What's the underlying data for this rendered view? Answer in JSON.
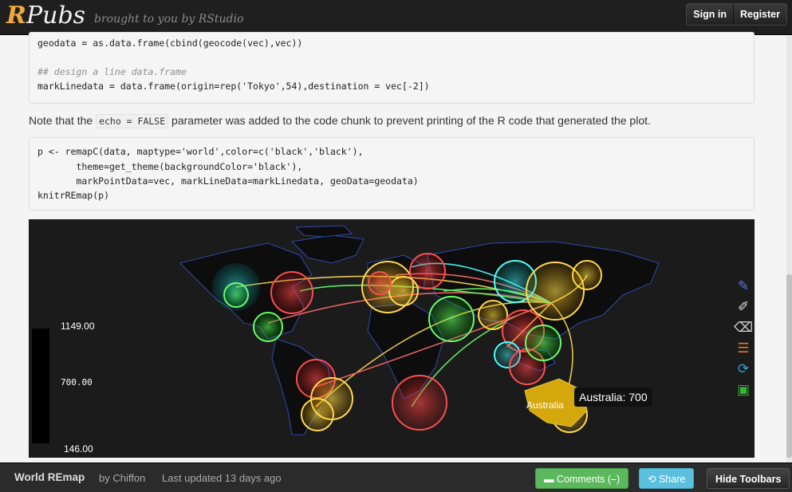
{
  "header": {
    "logo_r": "R",
    "logo_rest": "Pubs",
    "tagline": "brought to you by RStudio",
    "sign_in": "Sign in",
    "register": "Register"
  },
  "code1": {
    "line1": "geodata = as.data.frame(cbind(geocode(vec),vec))",
    "comment": "## design a line data.frame",
    "line3": "markLinedata = data.frame(origin=rep('Tokyo',54),destination = vec[-2])"
  },
  "note": {
    "before": "Note that the",
    "code": "echo = FALSE",
    "after": "parameter was added to the code chunk to prevent printing of the R code that generated the plot."
  },
  "code2": {
    "line1": "p <- remapC(data, maptype='world',color=c('black','black'),",
    "line2": "       theme=get_theme(backgroundColor='black'),",
    "line3": "       markPointData=vec, markLineData=markLinedata, geoData=geodata)",
    "line4": "knitrREmap(p)"
  },
  "map": {
    "legend_max": "1149.00",
    "legend_mid": "700.00",
    "legend_min": "146.00",
    "region_label": "Australia",
    "tooltip": "Australia: 700",
    "background": "#1b1b1b",
    "toolbox_icons": [
      "mark-icon",
      "erase-icon",
      "clear-icon",
      "data-view-icon",
      "restore-icon",
      "save-icon"
    ]
  },
  "footer": {
    "title": "World REmap",
    "by": "by Chiffon",
    "updated": "Last updated 13 days ago",
    "comments": "Comments (–)",
    "share": "Share",
    "hide_toolbars": "Hide Toolbars"
  }
}
